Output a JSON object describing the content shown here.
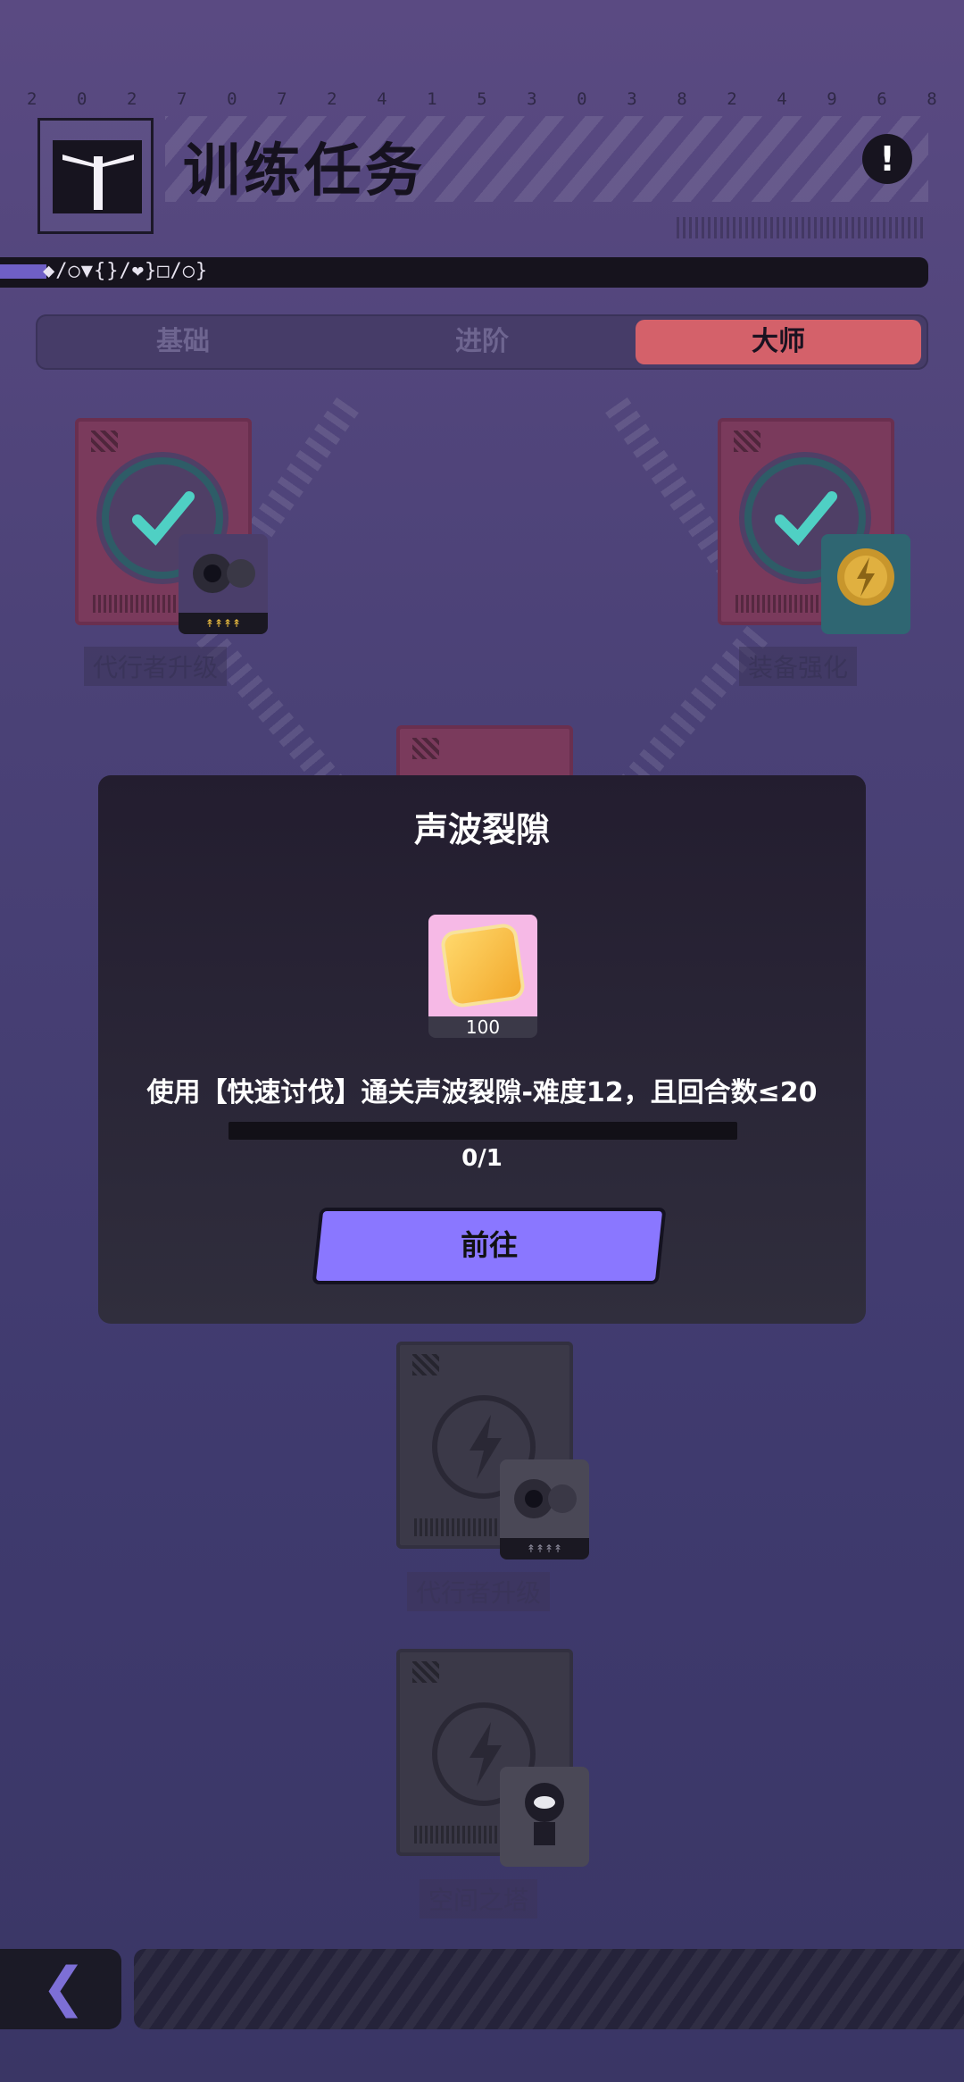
{
  "header": {
    "digits": [
      "2",
      "0",
      "2",
      "7",
      "0",
      "7",
      "2",
      "4",
      "1",
      "5",
      "3",
      "0",
      "3",
      "8",
      "2",
      "4",
      "9",
      "6",
      "8"
    ],
    "title": "训练任务",
    "info_icon": "exclamation-icon",
    "code_text": "◆/○▼{}/❤}□/○}"
  },
  "tabs": [
    {
      "label": "基础",
      "active": false
    },
    {
      "label": "进阶",
      "active": false
    },
    {
      "label": "大师",
      "active": true
    }
  ],
  "cards": [
    {
      "label": "代行者升级",
      "status": "completed"
    },
    {
      "label": "装备强化",
      "status": "completed"
    },
    {
      "label": "代行者升级",
      "status": "locked"
    },
    {
      "label": "空间之塔",
      "status": "locked"
    }
  ],
  "dialog": {
    "title": "声波裂隙",
    "reward_count": "100",
    "description": "使用【快速讨伐】通关声波裂隙-难度12，且回合数≤20",
    "progress_text": "0/1",
    "progress_fraction": 0,
    "go_button": "前往"
  },
  "footer": {
    "back_icon": "chevron-left-icon",
    "back_glyph": "❮"
  },
  "colors": {
    "accent": "#8a77ff",
    "active_tab": "#d4616a",
    "card_red": "#7a3a5c",
    "card_grey": "#3b3948"
  }
}
